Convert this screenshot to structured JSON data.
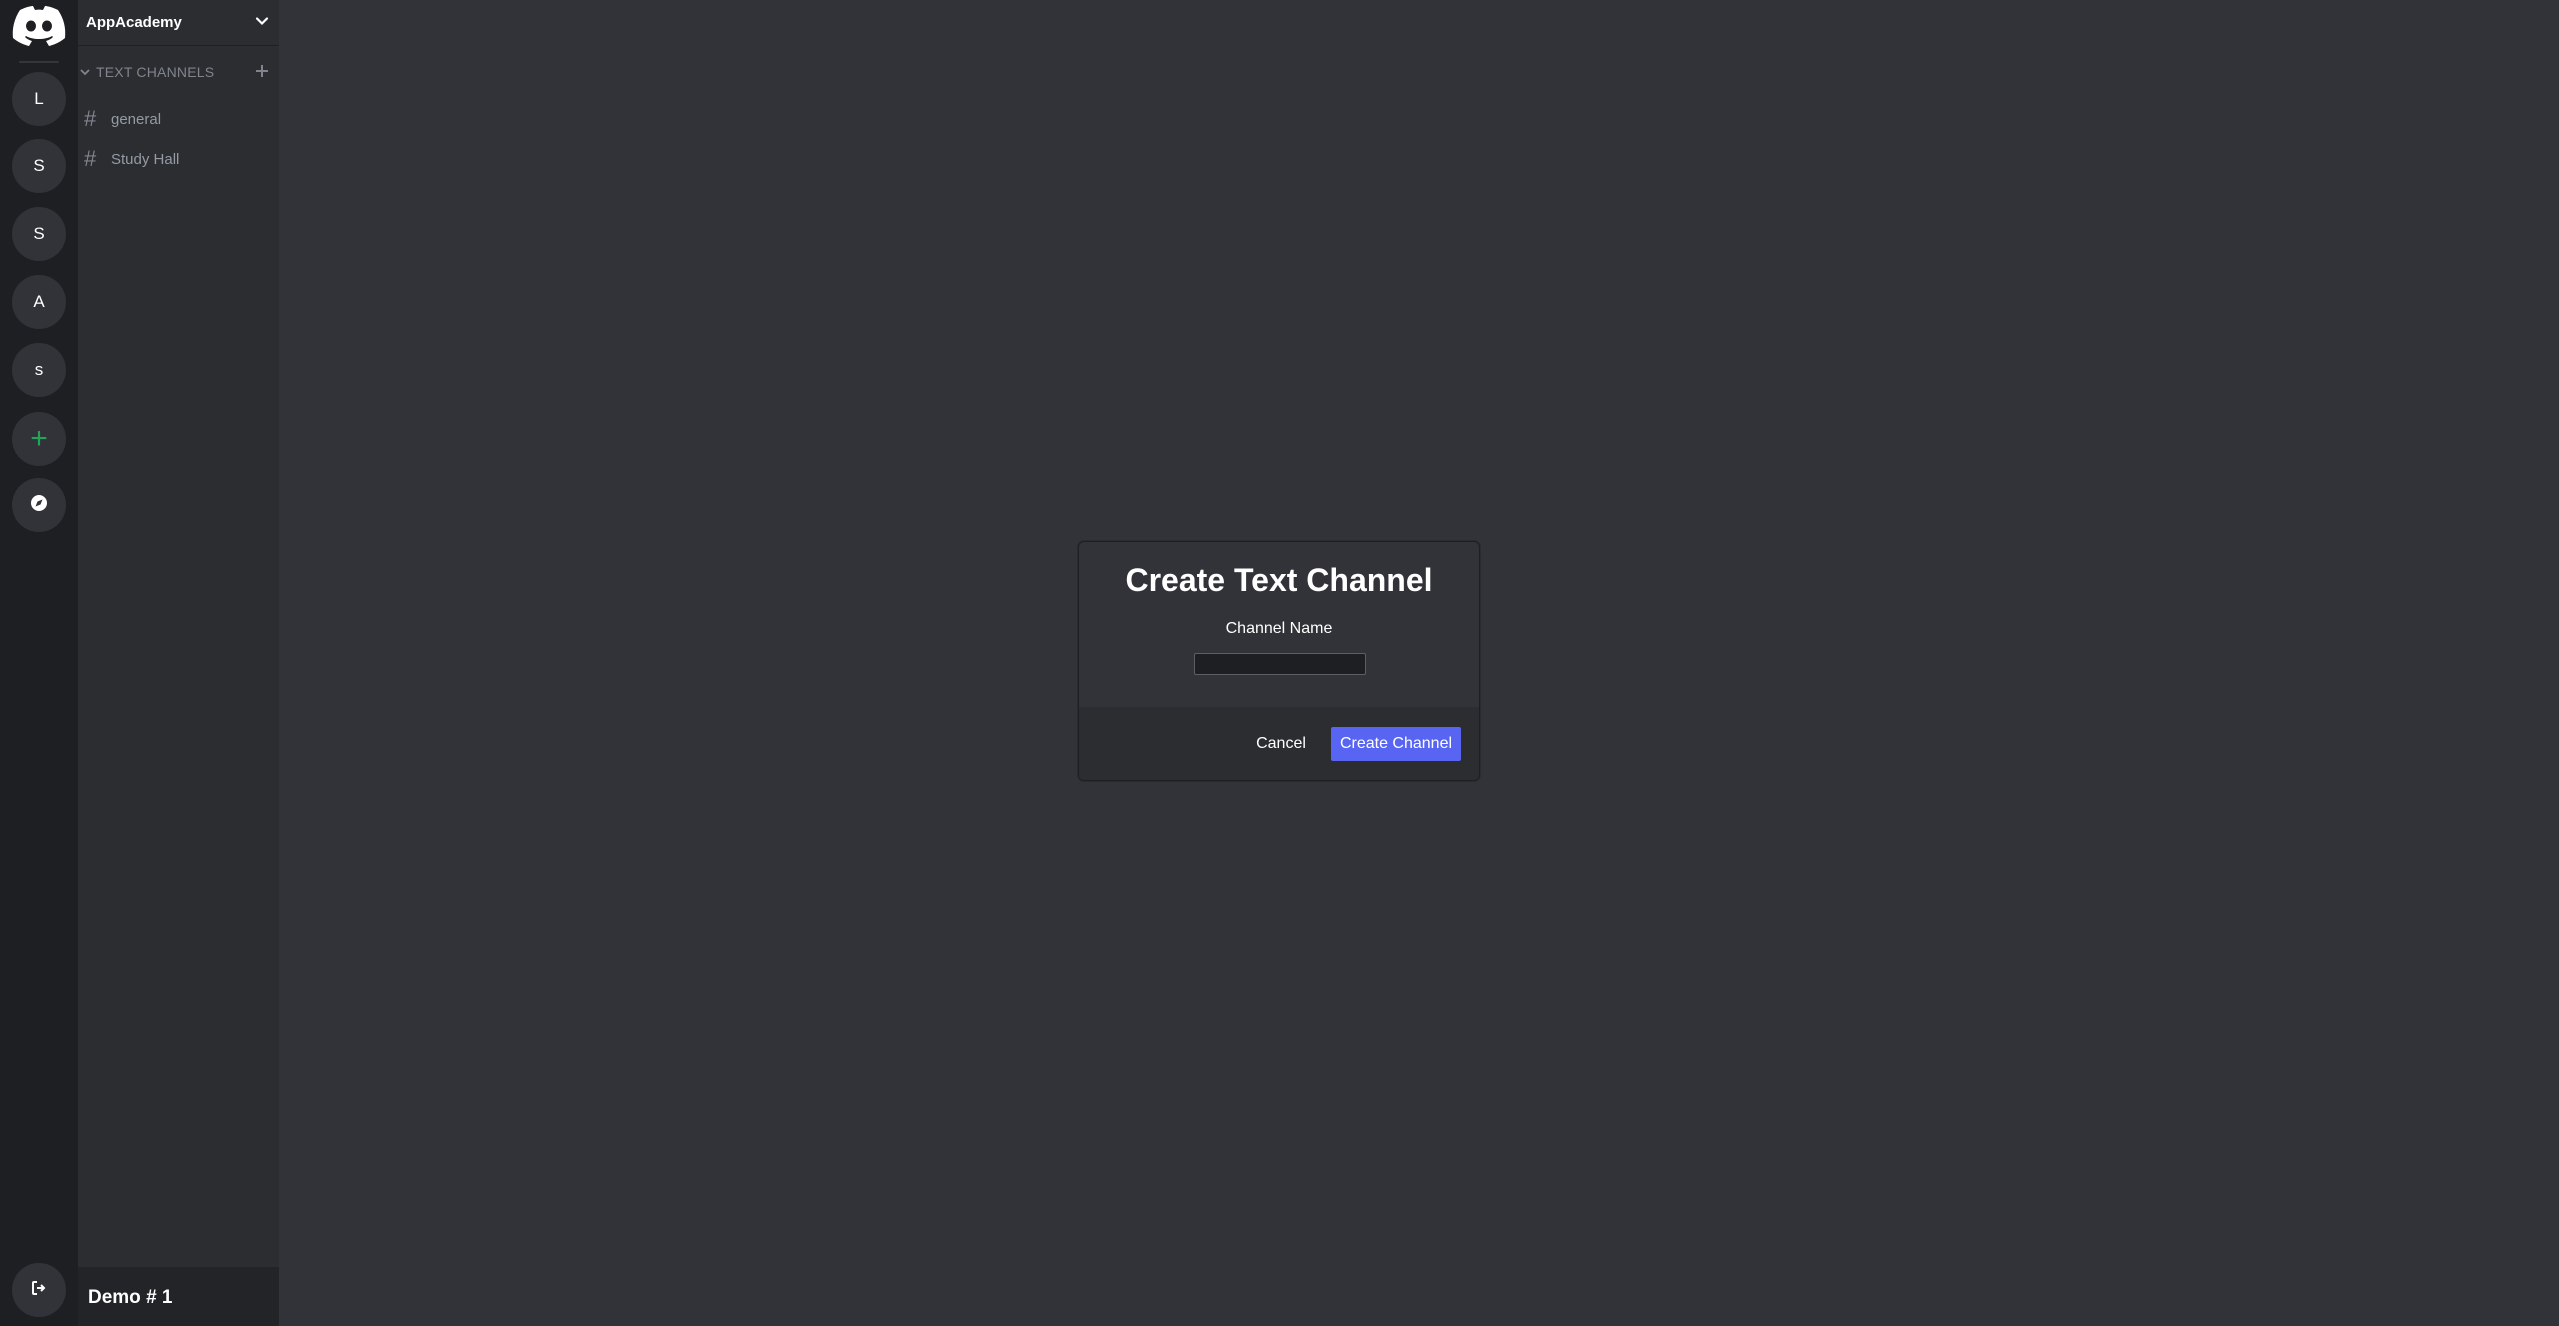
{
  "colors": {
    "rail_bg": "#1e1f22",
    "sidebar_bg": "#2b2d31",
    "main_bg": "#313338",
    "accent": "#5865f2",
    "add_server_green": "#23a559"
  },
  "server_rail": {
    "home_icon": "discord-logo-icon",
    "servers": [
      {
        "label": "L"
      },
      {
        "label": "S"
      },
      {
        "label": "S"
      },
      {
        "label": "A"
      },
      {
        "label": "s"
      }
    ],
    "add_server_label": "+",
    "explore_icon": "compass-icon",
    "logout_icon": "logout-icon"
  },
  "sidebar": {
    "server_name": "AppAcademy",
    "category_label": "TEXT CHANNELS",
    "channels": [
      {
        "hash": "#",
        "name": "general"
      },
      {
        "hash": "#",
        "name": "Study Hall"
      }
    ],
    "user_name": "Demo # 1"
  },
  "modal": {
    "title": "Create Text Channel",
    "field_label": "Channel Name",
    "input_value": "",
    "cancel_label": "Cancel",
    "create_label": "Create Channel"
  }
}
